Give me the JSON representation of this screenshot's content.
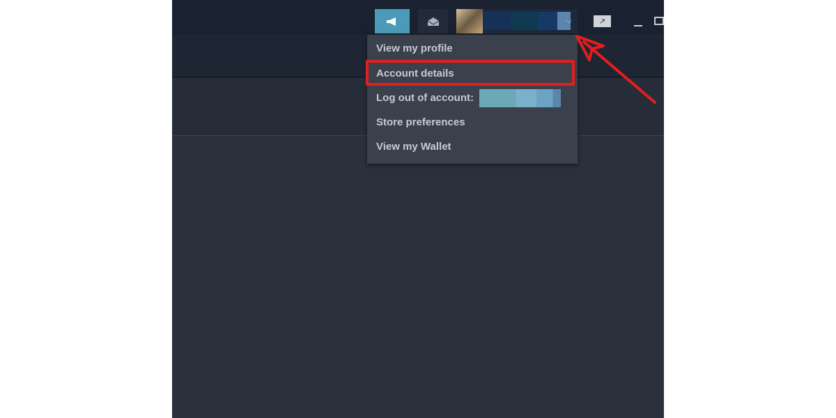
{
  "colors": {
    "accent": "#4b9ab8",
    "highlight": "#e41e1e",
    "menu_bg": "#3a404c",
    "menu_text": "#c6cbd3"
  },
  "topbar": {
    "announcement_icon": "megaphone-icon",
    "mail_icon": "envelope-icon",
    "dropdown_icon": "chevron-down-icon",
    "fullscreen_icon": "expand-icon",
    "minimize_icon": "minimize-icon",
    "restore_icon": "restore-icon"
  },
  "menu": {
    "items": [
      {
        "label": "View my profile"
      },
      {
        "label": "Account details",
        "highlighted": true
      },
      {
        "label": "Log out of account:"
      },
      {
        "label": "Store preferences"
      },
      {
        "label": "View my Wallet"
      }
    ]
  }
}
